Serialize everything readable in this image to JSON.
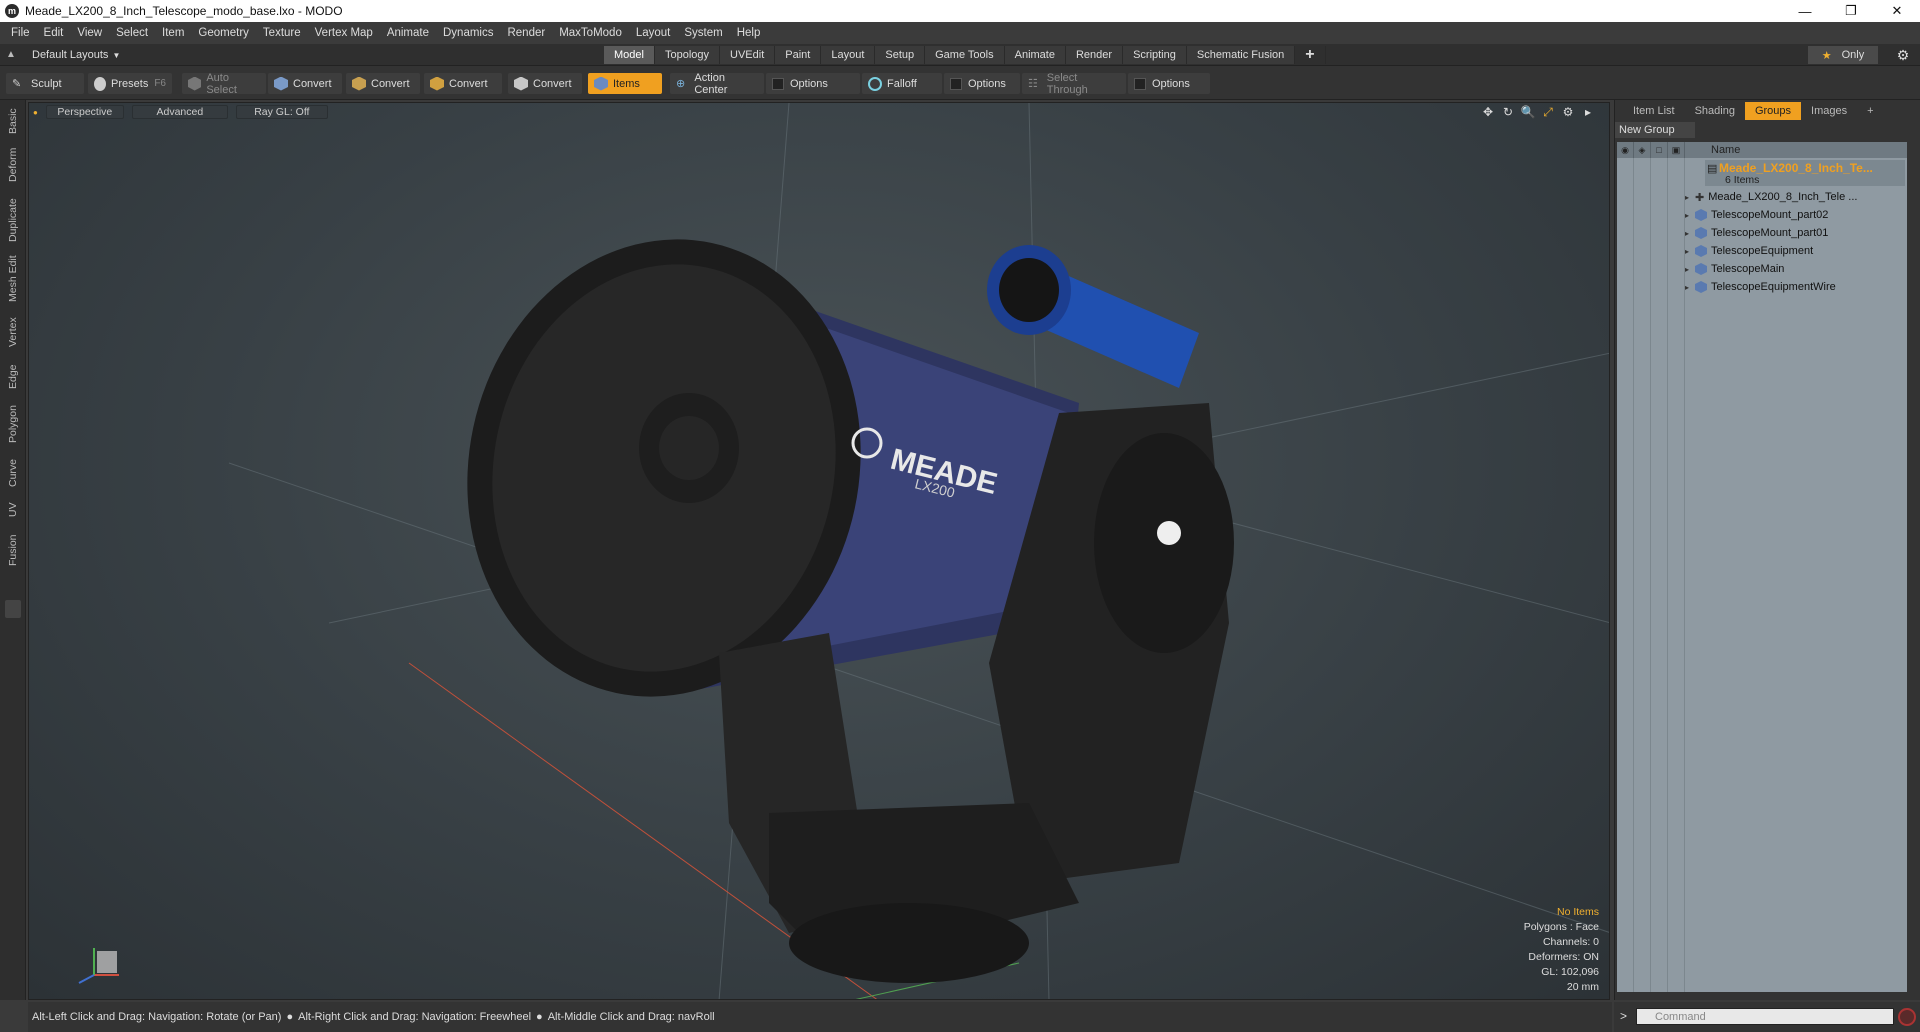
{
  "window": {
    "title": "Meade_LX200_8_Inch_Telescope_modo_base.lxo - MODO",
    "app_icon": "modo-logo-icon",
    "controls": [
      "minimize",
      "maximize",
      "close"
    ]
  },
  "menubar": [
    "File",
    "Edit",
    "View",
    "Select",
    "Item",
    "Geometry",
    "Texture",
    "Vertex Map",
    "Animate",
    "Dynamics",
    "Render",
    "MaxToModo",
    "Layout",
    "System",
    "Help"
  ],
  "layoutbar": {
    "layout_select": "Default Layouts",
    "tabs": [
      "Model",
      "Topology",
      "UVEdit",
      "Paint",
      "Layout",
      "Setup",
      "Game Tools",
      "Animate",
      "Render",
      "Scripting",
      "Schematic Fusion"
    ],
    "active_tab": "Model",
    "only_label": "Only"
  },
  "toolbar": {
    "sculpt": "Sculpt",
    "presets": "Presets",
    "presets_shortcut": "F6",
    "auto_select": "Auto Select",
    "convert1": "Convert",
    "convert2": "Convert",
    "convert3": "Convert",
    "convert4": "Convert",
    "items": "Items",
    "action_center": "Action Center",
    "options1": "Options",
    "falloff": "Falloff",
    "options2": "Options",
    "select_through": "Select Through",
    "options3": "Options"
  },
  "lefttools": [
    "Basic",
    "Deform",
    "Duplicate",
    "Mesh Edit",
    "Vertex",
    "Edge",
    "Polygon",
    "Curve",
    "UV",
    "Fusion"
  ],
  "viewport": {
    "view": "Perspective",
    "shading": "Advanced",
    "raygl": "Ray GL: Off",
    "info": {
      "selection": "No Items",
      "polygons": "Polygons : Face",
      "channels": "Channels: 0",
      "deformers": "Deformers: ON",
      "gl": "GL: 102,096",
      "scale": "20 mm"
    },
    "model_label": "MEADE",
    "model_sublabel": "LX200"
  },
  "rightpanel": {
    "tabs": [
      "Item List",
      "Shading",
      "Groups",
      "Images",
      "+"
    ],
    "active_tab": "Groups",
    "new_group": "New Group",
    "name_header": "Name",
    "root": {
      "name": "Meade_LX200_8_Inch_Te...",
      "count": "6 Items"
    },
    "items": [
      "Meade_LX200_8_Inch_Tele ...",
      "TelescopeMount_part02",
      "TelescopeMount_part01",
      "TelescopeEquipment",
      "TelescopeMain",
      "TelescopeEquipmentWire"
    ]
  },
  "statusbar": {
    "hint1": "Alt-Left Click and Drag: Navigation: Rotate (or Pan)",
    "hint2": "Alt-Right Click and Drag: Navigation: Freewheel",
    "hint3": "Alt-Middle Click and Drag: navRoll"
  },
  "command": {
    "prompt": ">",
    "placeholder": "Command"
  }
}
